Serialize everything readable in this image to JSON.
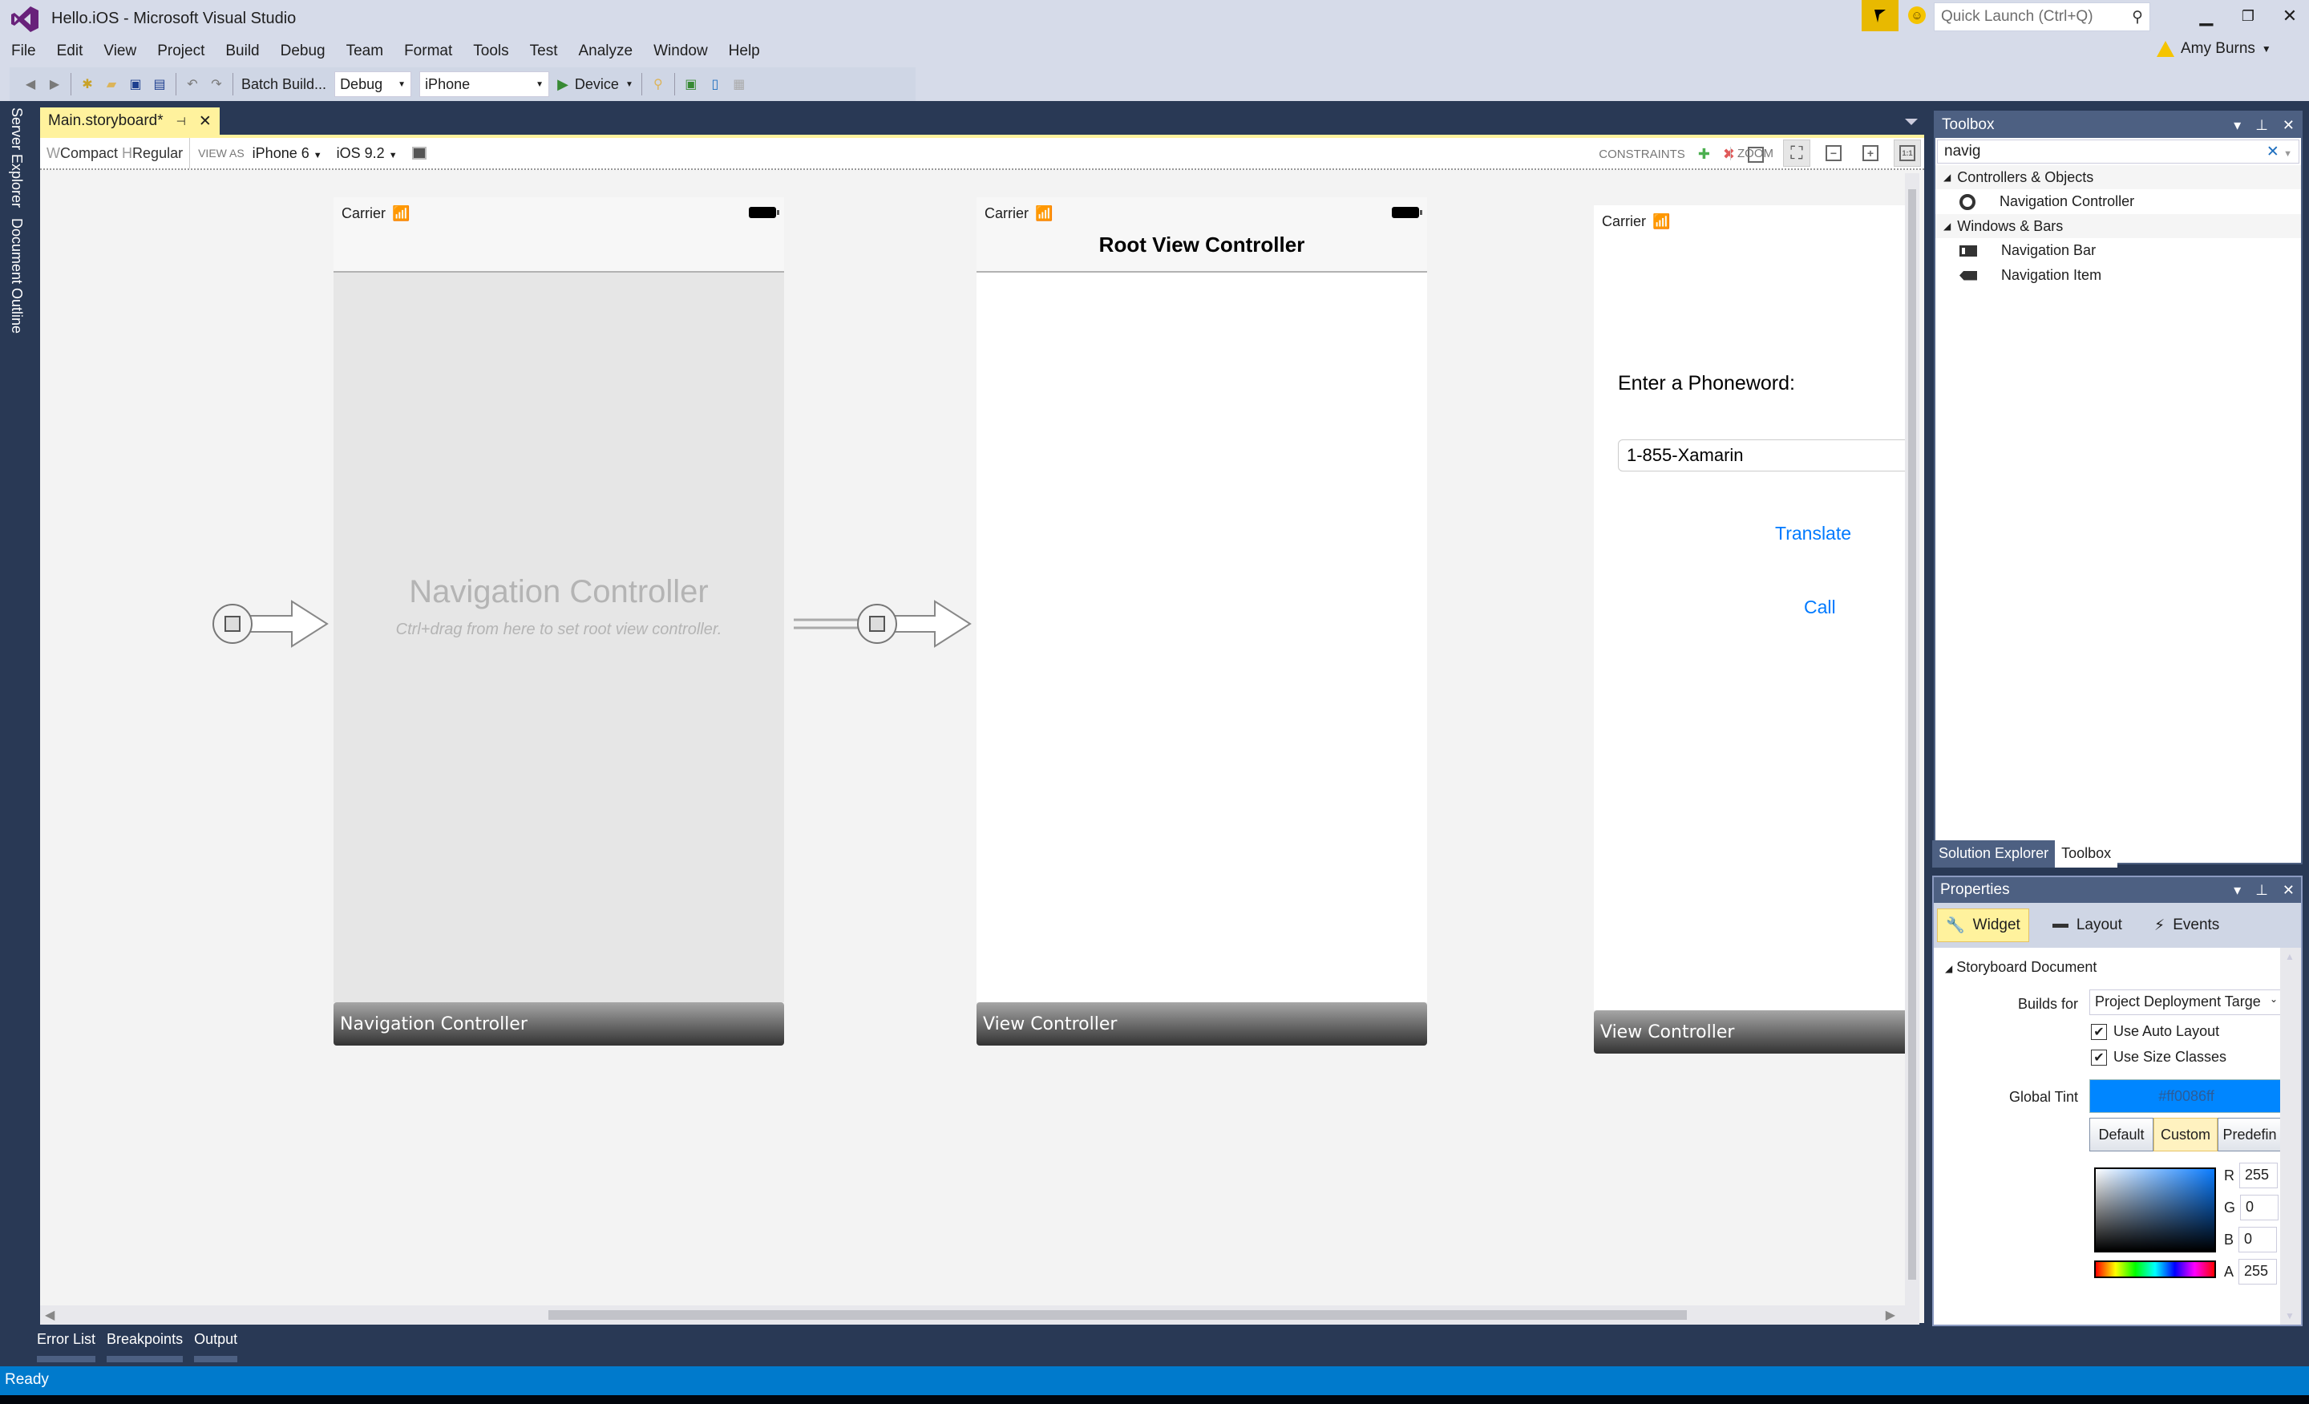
{
  "window": {
    "title": "Hello.iOS - Microsoft Visual Studio",
    "quick_launch_placeholder": "Quick Launch (Ctrl+Q)",
    "user": "Amy Burns"
  },
  "menu": [
    "File",
    "Edit",
    "View",
    "Project",
    "Build",
    "Debug",
    "Team",
    "Format",
    "Tools",
    "Test",
    "Analyze",
    "Window",
    "Help"
  ],
  "toolbar": {
    "batch_build": "Batch Build...",
    "configuration": "Debug",
    "platform": "iPhone",
    "run_target": "Device"
  },
  "left_tabs": [
    "Server Explorer",
    "Document Outline"
  ],
  "document_tab": {
    "label": "Main.storyboard*"
  },
  "designer_toolbar": {
    "size_w_prefix": "W",
    "size_w": "Compact",
    "size_h_prefix": "H",
    "size_h": "Regular",
    "view_as_label": "VIEW AS",
    "device": "iPhone 6",
    "ios_version": "iOS 9.2",
    "constraints_label": "CONSTRAINTS",
    "zoom_label": "ZOOM",
    "zoom_actual": "1:1"
  },
  "scenes": {
    "navigation_controller": {
      "carrier": "Carrier",
      "placeholder_title": "Navigation Controller",
      "placeholder_hint": "Ctrl+drag from here to set root view controller.",
      "label": "Navigation Controller"
    },
    "root_view_controller": {
      "carrier": "Carrier",
      "nav_title": "Root View Controller",
      "label": "View Controller"
    },
    "phoneword_controller": {
      "carrier": "Carrier",
      "prompt": "Enter a Phoneword:",
      "phone_field_value": "1-855-Xamarin",
      "translate_button": "Translate",
      "call_button": "Call",
      "label": "View Controller"
    }
  },
  "toolbox": {
    "title": "Toolbox",
    "search_value": "navig",
    "categories": [
      {
        "name": "Controllers & Objects",
        "items": [
          "Navigation Controller"
        ]
      },
      {
        "name": "Windows & Bars",
        "items": [
          "Navigation Bar",
          "Navigation Item"
        ]
      }
    ]
  },
  "panel_tabs": [
    "Solution Explorer",
    "Toolbox"
  ],
  "properties": {
    "title": "Properties",
    "tabs": [
      "Widget",
      "Layout",
      "Events"
    ],
    "section": "Storyboard Document",
    "builds_for_label": "Builds for",
    "builds_for_value": "Project Deployment Targe",
    "use_auto_layout": "Use Auto Layout",
    "use_auto_layout_checked": true,
    "use_size_classes": "Use Size Classes",
    "use_size_classes_checked": true,
    "global_tint_label": "Global Tint",
    "global_tint_value": "#ff0086ff",
    "global_tint_color": "#0086ff",
    "tint_modes": [
      "Default",
      "Custom",
      "Predefin"
    ],
    "tint_mode_selected": "Custom",
    "rgba": {
      "R": "255",
      "G": "0",
      "B": "0",
      "A": "255"
    }
  },
  "bottom_tabs": [
    "Error List",
    "Breakpoints",
    "Output"
  ],
  "status": "Ready",
  "colors": {
    "accent": "#007acc",
    "ios_tint": "#007aff",
    "tab_highlight": "#fff29d"
  }
}
